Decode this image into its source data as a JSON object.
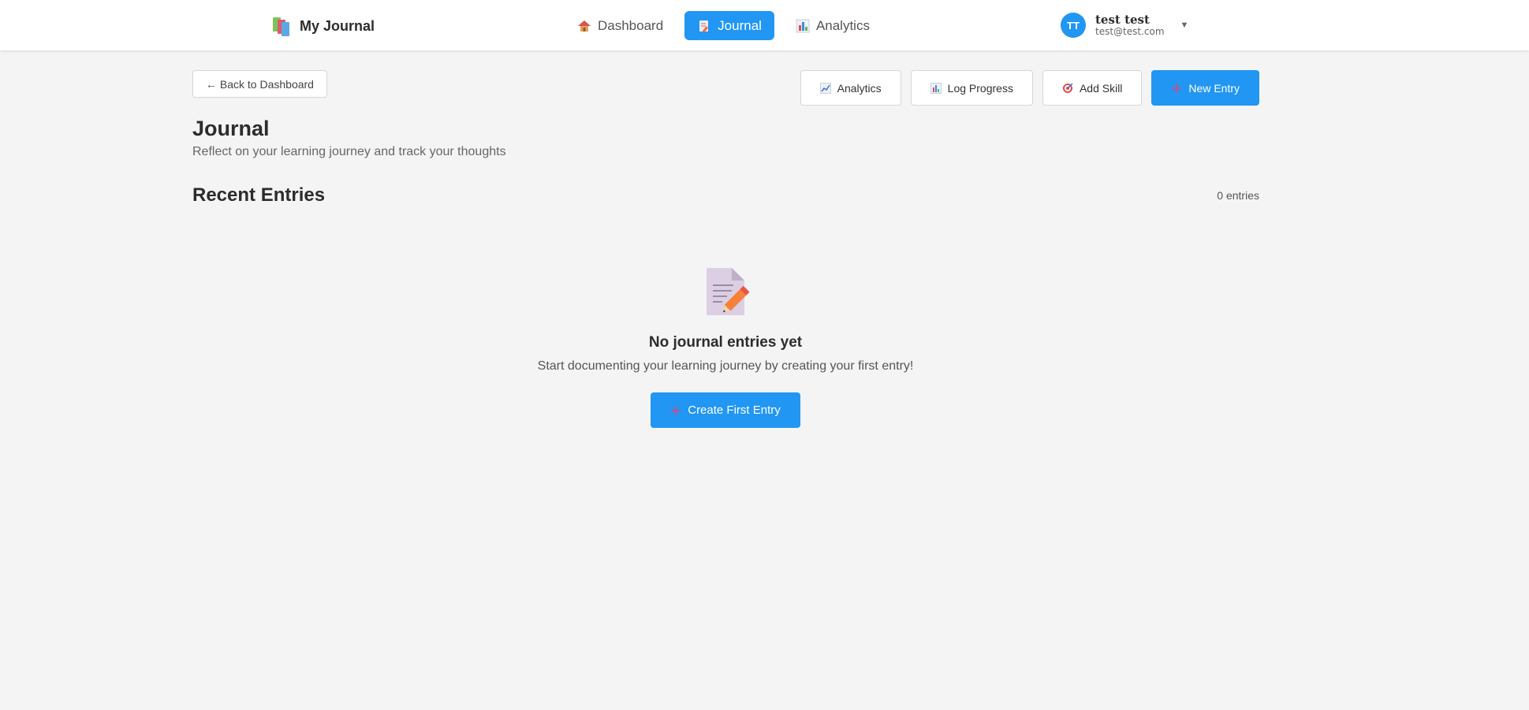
{
  "header": {
    "brand": "My Journal",
    "nav": [
      {
        "label": "Dashboard",
        "icon": "house-icon"
      },
      {
        "label": "Journal",
        "icon": "memo-icon",
        "active": true
      },
      {
        "label": "Analytics",
        "icon": "bar-chart-icon"
      }
    ],
    "user": {
      "initials": "TT",
      "name": "test test",
      "email": "test@test.com",
      "caret": "▼"
    }
  },
  "toolbar": {
    "back_label": "← Back to Dashboard",
    "analytics_label": "Analytics",
    "log_progress_label": "Log Progress",
    "add_skill_label": "Add Skill",
    "new_entry_label": "New Entry"
  },
  "page": {
    "title": "Journal",
    "subtitle": "Reflect on your learning journey and track your thoughts",
    "section_title": "Recent Entries",
    "entry_count": "0 entries"
  },
  "empty_state": {
    "title": "No journal entries yet",
    "text": "Start documenting your learning journey by creating your first entry!",
    "button_label": "Create First Entry"
  },
  "colors": {
    "accent": "#2196f3",
    "background": "#f4f4f4",
    "plus": "#e0457b"
  }
}
